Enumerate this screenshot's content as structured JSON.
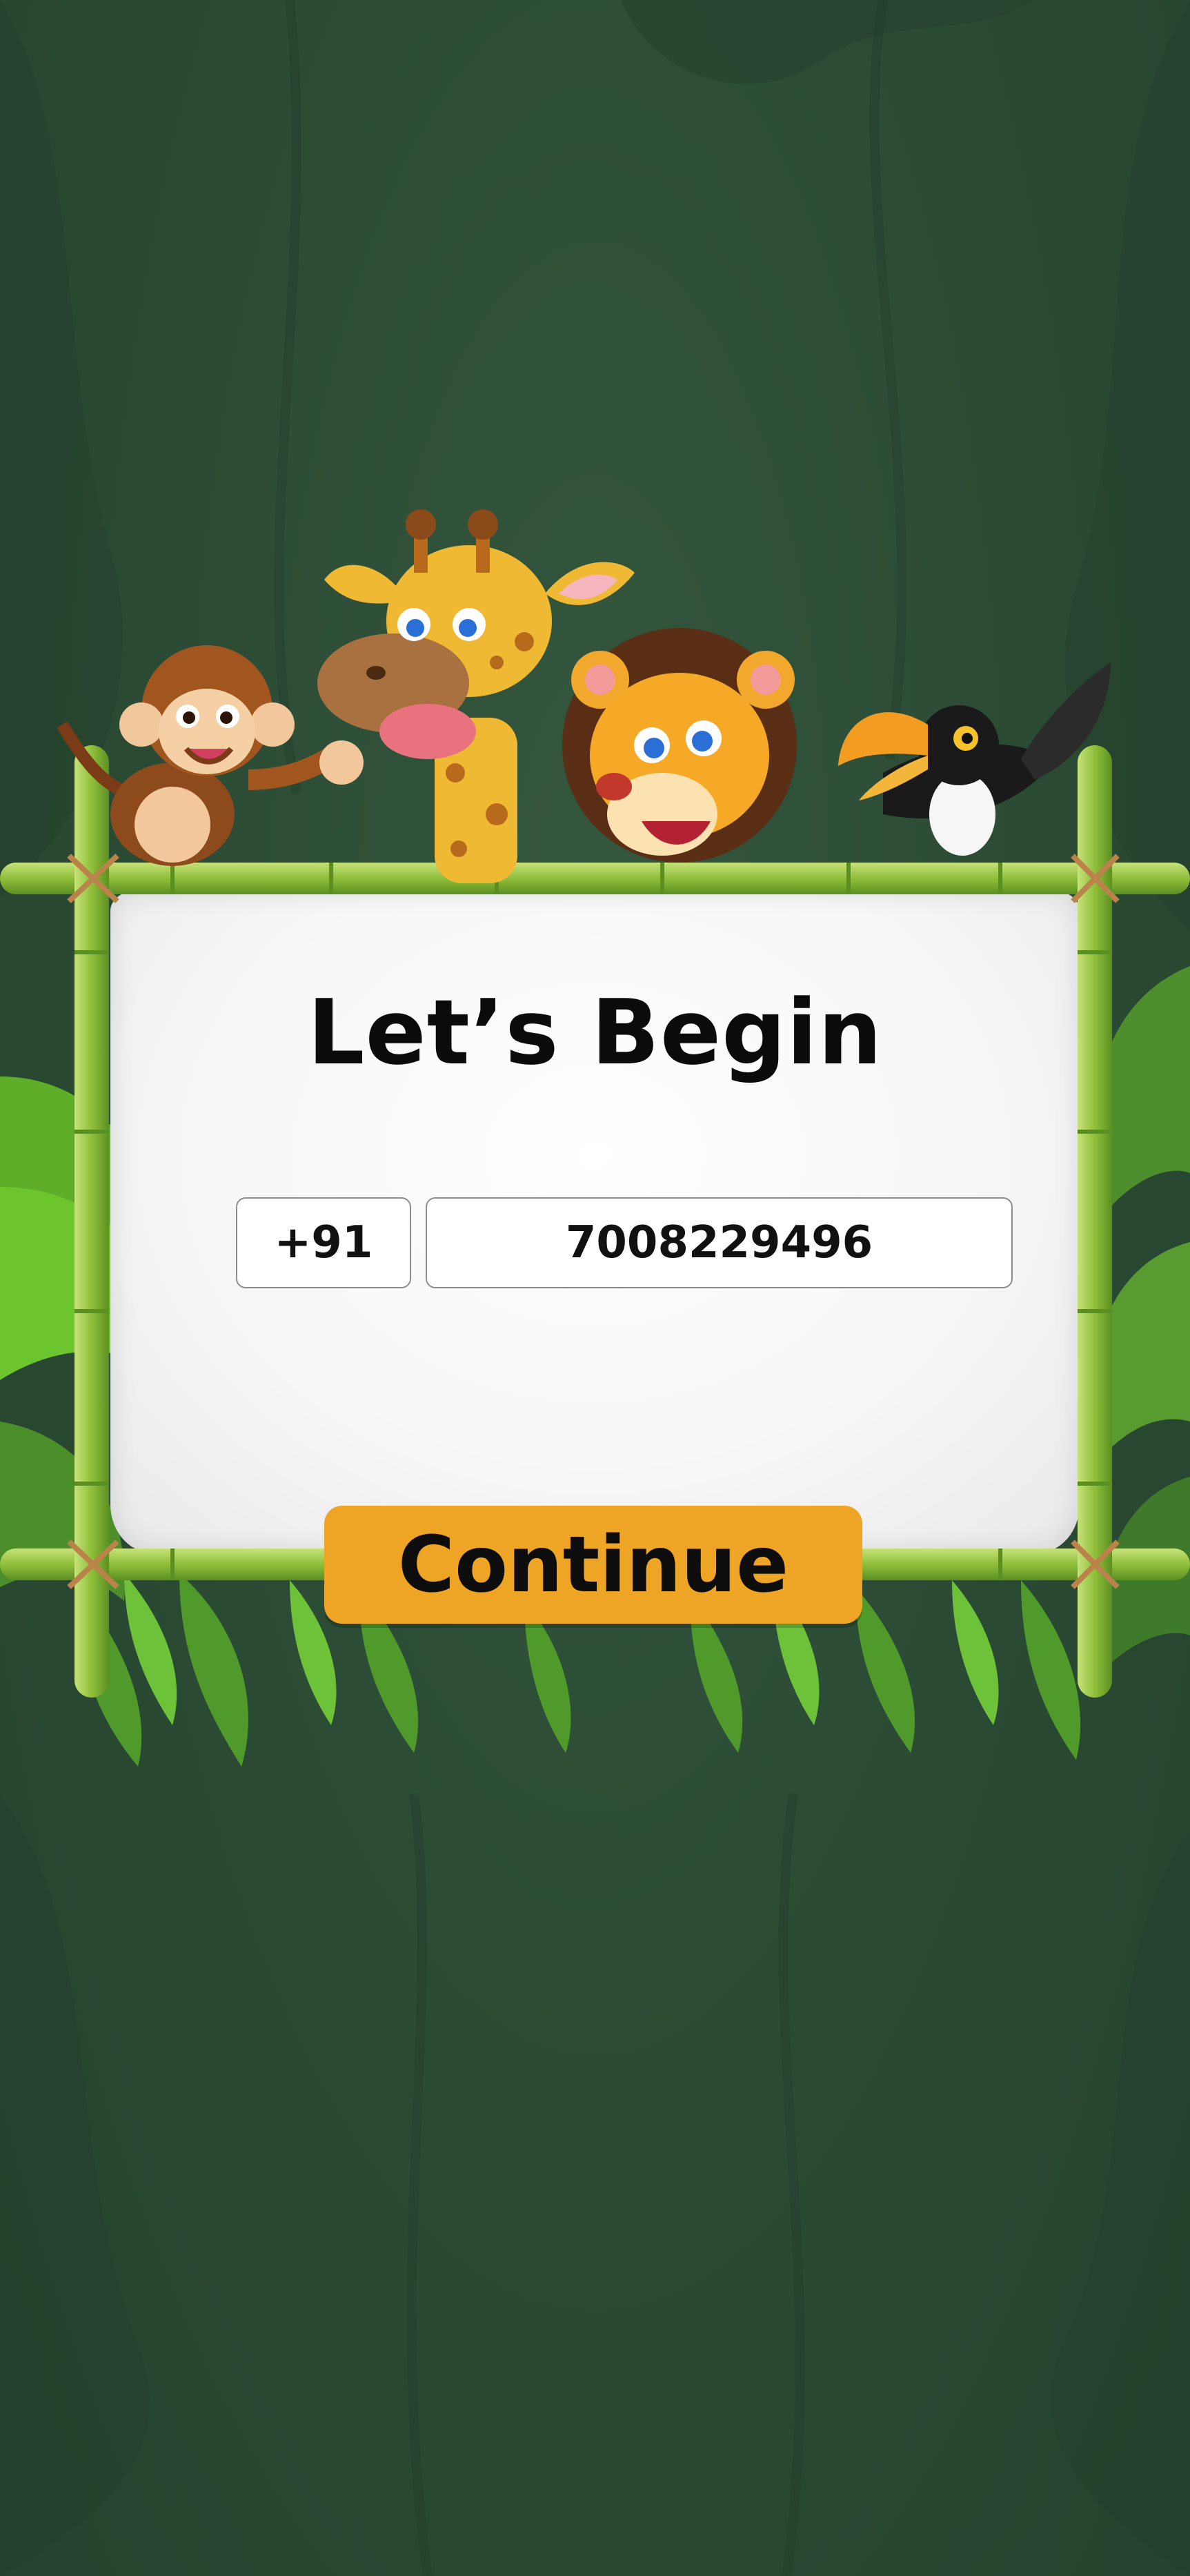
{
  "screen": {
    "title": "Let’s Begin"
  },
  "phone_form": {
    "country_code": "+91",
    "phone_number": "7008229496"
  },
  "actions": {
    "continue_label": "Continue"
  },
  "theme": {
    "background": "#2c4c35",
    "button_color": "#eea424",
    "bamboo_color": "#8fbf3a"
  },
  "decorations": {
    "characters": [
      "monkey",
      "giraffe",
      "lion",
      "toucan"
    ]
  }
}
